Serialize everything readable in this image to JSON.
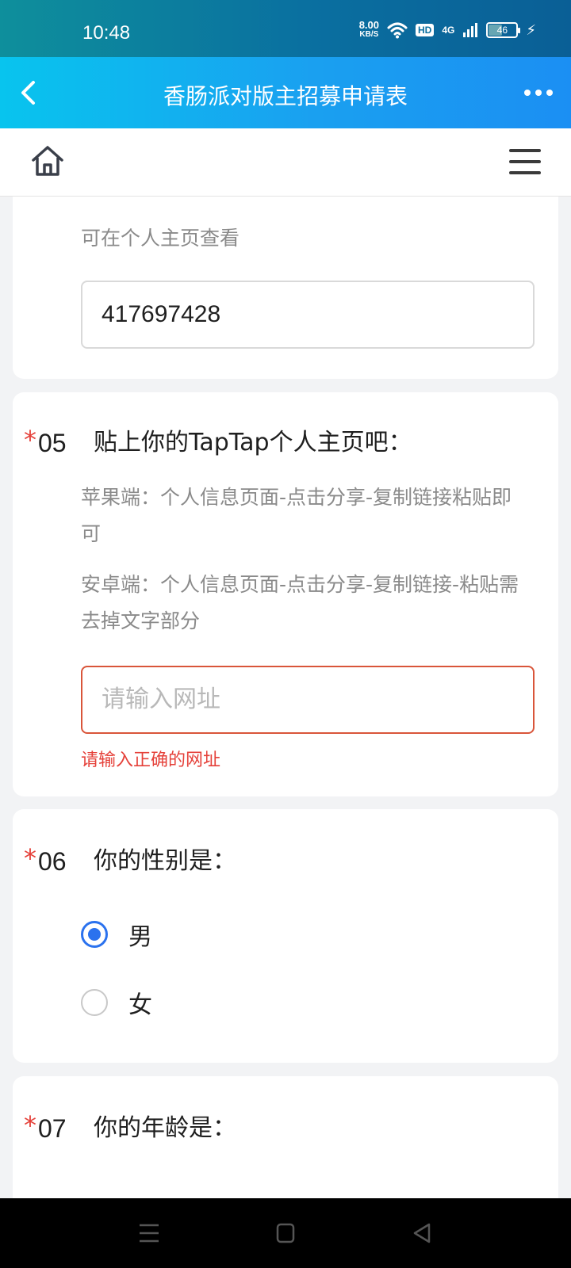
{
  "status_bar": {
    "time": "10:48",
    "speed_value": "8.00",
    "speed_unit": "KB/S",
    "hd_label": "HD",
    "signal_label": "4G",
    "battery": "46"
  },
  "header": {
    "title": "香肠派对版主招募申请表"
  },
  "questions": {
    "q04": {
      "hint": "可在个人主页查看",
      "value": "417697428"
    },
    "q05": {
      "required_mark": "*",
      "number": "05",
      "title": "贴上你的TapTap个人主页吧：",
      "hint1": "苹果端：个人信息页面-点击分享-复制链接粘贴即可",
      "hint2": "安卓端：个人信息页面-点击分享-复制链接-粘贴需去掉文字部分",
      "placeholder": "请输入网址",
      "error": "请输入正确的网址"
    },
    "q06": {
      "required_mark": "*",
      "number": "06",
      "title": "你的性别是：",
      "options": [
        "男",
        "女"
      ],
      "selected": "男"
    },
    "q07": {
      "required_mark": "*",
      "number": "07",
      "title": "你的年龄是："
    }
  },
  "colors": {
    "accent_blue": "#2b72ee",
    "error_red": "#e5413a",
    "header_gradient_start": "#08c4ee",
    "header_gradient_end": "#1b8ff3"
  }
}
